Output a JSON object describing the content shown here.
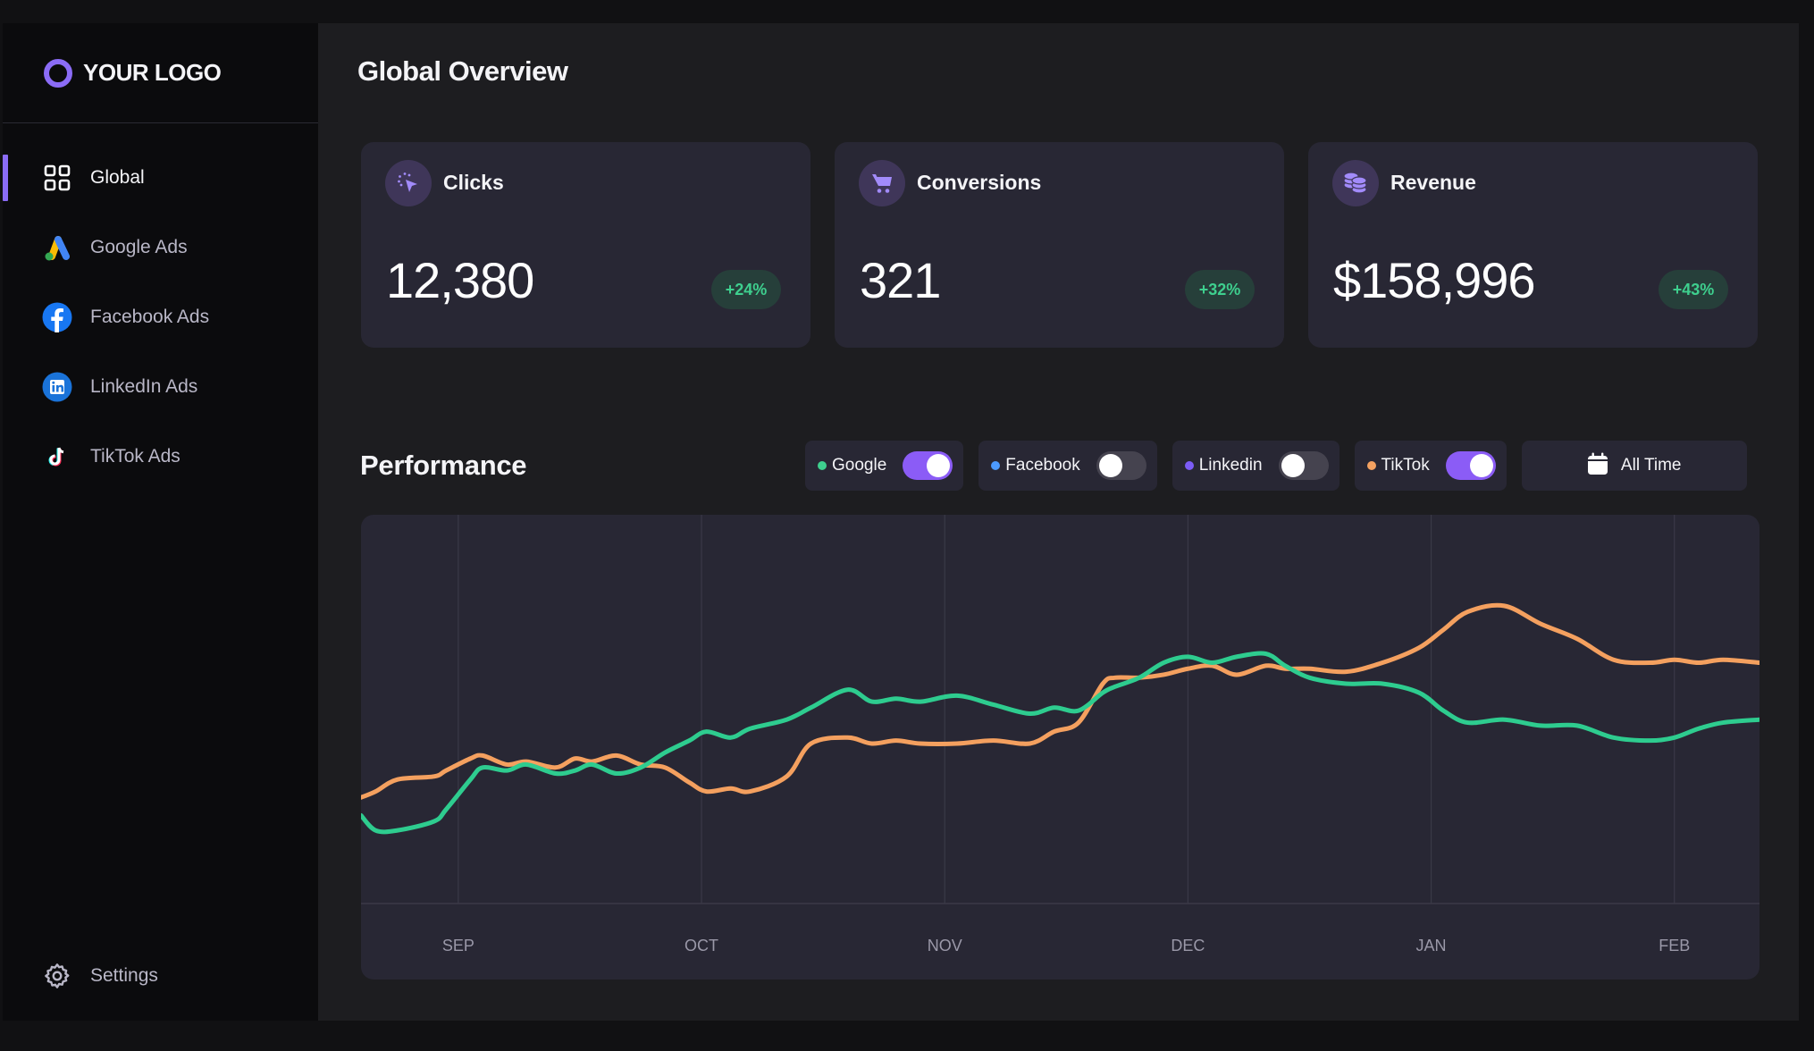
{
  "logo": {
    "text": "YOUR LOGO"
  },
  "sidebar": {
    "items": [
      {
        "label": "Global",
        "icon": "grid-icon",
        "active": true
      },
      {
        "label": "Google Ads",
        "icon": "google-ads-icon",
        "active": false
      },
      {
        "label": "Facebook Ads",
        "icon": "facebook-icon",
        "active": false
      },
      {
        "label": "LinkedIn Ads",
        "icon": "linkedin-icon",
        "active": false
      },
      {
        "label": "TikTok Ads",
        "icon": "tiktok-icon",
        "active": false
      }
    ],
    "settings_label": "Settings"
  },
  "header": {
    "title": "Global Overview"
  },
  "metrics": [
    {
      "title": "Clicks",
      "value": "12,380",
      "change": "+24%",
      "icon": "cursor-click-icon"
    },
    {
      "title": "Conversions",
      "value": "321",
      "change": "+32%",
      "icon": "shopping-cart-icon"
    },
    {
      "title": "Revenue",
      "value": "$158,996",
      "change": "+43%",
      "icon": "coins-icon"
    }
  ],
  "performance": {
    "title": "Performance",
    "filters": [
      {
        "label": "Google",
        "color": "#3ecf8e",
        "enabled": true
      },
      {
        "label": "Facebook",
        "color": "#4c9aff",
        "enabled": false
      },
      {
        "label": "Linkedin",
        "color": "#7c5cf6",
        "enabled": false
      },
      {
        "label": "TikTok",
        "color": "#f4a261",
        "enabled": true
      }
    ],
    "range_label": "All Time"
  },
  "colors": {
    "accent": "#8b5cf6",
    "positive": "#3ecf8e",
    "google": "#2ecc8f",
    "tiktok": "#f4a05f"
  },
  "chart_data": {
    "type": "line",
    "title": "Performance",
    "xlabel": "",
    "ylabel": "",
    "x_ticks": [
      "SEP",
      "OCT",
      "NOV",
      "DEC",
      "JAN",
      "FEB"
    ],
    "x_tick_positions": [
      0.4,
      1.4,
      2.4,
      3.4,
      4.4,
      5.4
    ],
    "xlim": [
      0,
      5.75
    ],
    "ylim": [
      0,
      100
    ],
    "grid": "vertical",
    "legend": "top-right toggles",
    "series": [
      {
        "name": "Google",
        "color": "#2ecc8f",
        "x": [
          0.0,
          0.06,
          0.15,
          0.3,
          0.35,
          0.45,
          0.5,
          0.6,
          0.68,
          0.8,
          0.88,
          0.95,
          1.05,
          1.15,
          1.25,
          1.35,
          1.42,
          1.52,
          1.6,
          1.75,
          1.85,
          2.0,
          2.1,
          2.2,
          2.3,
          2.45,
          2.6,
          2.75,
          2.85,
          2.95,
          3.05,
          3.1,
          3.2,
          3.3,
          3.4,
          3.5,
          3.6,
          3.72,
          3.8,
          3.9,
          4.05,
          4.2,
          4.35,
          4.45,
          4.55,
          4.7,
          4.85,
          5.0,
          5.15,
          5.3,
          5.4,
          5.5,
          5.6,
          5.75
        ],
        "y": [
          16,
          11,
          11,
          14,
          18,
          28,
          32,
          31,
          33,
          30,
          31,
          33,
          30,
          32,
          37,
          41,
          44,
          42,
          45,
          48,
          52,
          58,
          54,
          55,
          54,
          56,
          53,
          50,
          52,
          51,
          57,
          59,
          62,
          67,
          69,
          67,
          69,
          70,
          66,
          62,
          60,
          60,
          57,
          51,
          47,
          48,
          46,
          46,
          42,
          41,
          42,
          45,
          47,
          48
        ]
      },
      {
        "name": "TikTok",
        "color": "#f4a05f",
        "x": [
          0.0,
          0.06,
          0.15,
          0.3,
          0.35,
          0.45,
          0.5,
          0.6,
          0.68,
          0.8,
          0.88,
          0.95,
          1.05,
          1.15,
          1.25,
          1.35,
          1.42,
          1.52,
          1.6,
          1.75,
          1.85,
          2.0,
          2.1,
          2.2,
          2.3,
          2.45,
          2.6,
          2.75,
          2.85,
          2.95,
          3.05,
          3.1,
          3.2,
          3.3,
          3.4,
          3.5,
          3.6,
          3.72,
          3.8,
          3.9,
          4.05,
          4.2,
          4.35,
          4.45,
          4.55,
          4.7,
          4.85,
          5.0,
          5.15,
          5.3,
          5.4,
          5.5,
          5.6,
          5.75
        ],
        "y": [
          22,
          24,
          28,
          29,
          31,
          35,
          36,
          33,
          34,
          32,
          35,
          34,
          36,
          33,
          32,
          27,
          24,
          25,
          24,
          29,
          40,
          42,
          40,
          41,
          40,
          40,
          41,
          40,
          44,
          47,
          60,
          62,
          62,
          63,
          65,
          66,
          63,
          66,
          65,
          65,
          64,
          67,
          72,
          78,
          84,
          86,
          80,
          75,
          68,
          67,
          68,
          67,
          68,
          67
        ]
      }
    ]
  }
}
